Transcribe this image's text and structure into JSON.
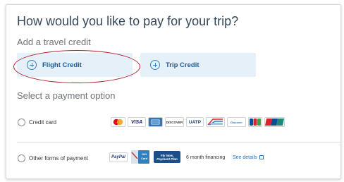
{
  "title": "How would you like to pay for your trip?",
  "travel_credit": {
    "heading": "Add a travel credit",
    "flight_credit_label": "Flight Credit",
    "trip_credit_label": "Trip Credit"
  },
  "payment": {
    "heading": "Select a payment option",
    "credit_card": {
      "label": "Credit card",
      "logos": [
        "mastercard",
        "VISA",
        "amex",
        "DISCOVER",
        "UATP",
        "diners",
        "Discover",
        "JCB",
        "UnionPay"
      ]
    },
    "other": {
      "label": "Other forms of payment",
      "paypal": "PayPal",
      "gift_card": "Gift Card",
      "fly_now": "Fly Now, Payment Plan",
      "financing": "6 month financing",
      "see_details": "See details"
    }
  },
  "colors": {
    "title": "#36495a",
    "button_bg": "#e6f0f8",
    "button_text": "#1f5a96",
    "link": "#1f6dc2",
    "highlight": "#b01c2e"
  }
}
